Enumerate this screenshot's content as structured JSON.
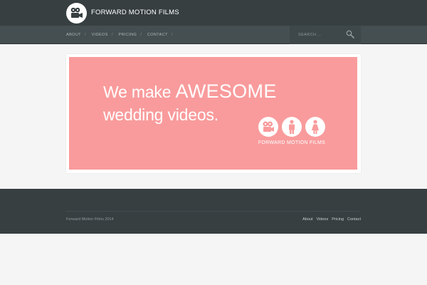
{
  "header": {
    "site_title": "FORWARD MOTION FILMS",
    "logo_icon": "film-camera-icon"
  },
  "nav": {
    "items": [
      {
        "label": "ABOUT"
      },
      {
        "label": "VIDEOS"
      },
      {
        "label": "PRICING"
      },
      {
        "label": "CONTACT"
      }
    ],
    "separator": "/",
    "search_placeholder": "SEARCH ...",
    "search_icon": "search-icon"
  },
  "banner": {
    "headline_prefix": "We make ",
    "headline_emphasis": "AWESOME",
    "headline_line2": "wedding videos.",
    "icons": [
      "film-camera-icon",
      "groom-icon",
      "bride-icon"
    ],
    "brand_caption": "FORWARD MOTION FILMS",
    "background_color": "#f99b9c"
  },
  "footer": {
    "copyright": "Forward Motion Films 2014",
    "links": [
      {
        "label": "About"
      },
      {
        "label": "Videos"
      },
      {
        "label": "Pricing"
      },
      {
        "label": "Contact"
      }
    ]
  },
  "colors": {
    "topbar": "#373f41",
    "navbar": "#454e51",
    "page_background": "#f5f5f5"
  }
}
